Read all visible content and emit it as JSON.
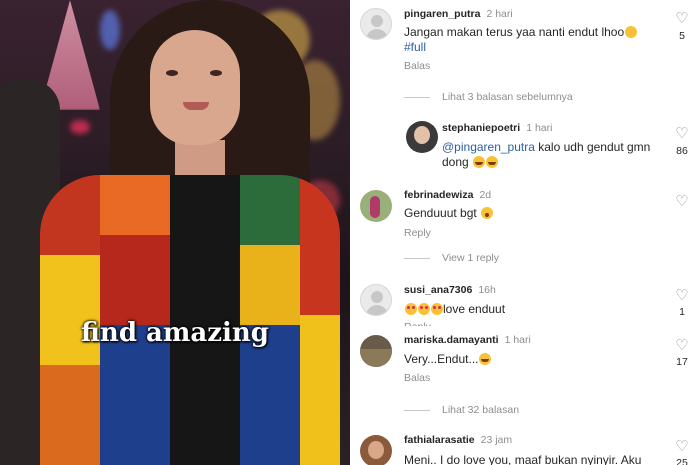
{
  "video": {
    "caption": "find amazing"
  },
  "comments": [
    {
      "username": "pingaren_putra",
      "time": "2 hari",
      "text": "Jangan makan terus yaa nanti endut lhoo",
      "hashtag": "#full",
      "reply_label": "Balas",
      "likes": "5",
      "avatar": "default-avatar"
    },
    {
      "more_replies": "Lihat 3 balasan sebelumnya"
    },
    {
      "username": "stephaniepoetri",
      "time": "1 hari",
      "mention": "@pingaren_putra",
      "text_line1": " kalo udh gendut gmn",
      "text_line2": "dong",
      "likes": "86",
      "avatar": "photo-avatar"
    },
    {
      "username": "febrinadewiza",
      "time": "2d",
      "text": "Genduuut bgt",
      "reply_label": "Reply",
      "avatar": "photo-avatar"
    },
    {
      "more_replies": "View 1 reply"
    },
    {
      "username": "susi_ana7306",
      "time": "16h",
      "text": "love enduut",
      "reply_label": "Reply",
      "likes": "1",
      "avatar": "default-avatar"
    },
    {
      "username": "mariska.damayanti",
      "time": "1 hari",
      "text": "Very...Endut...",
      "reply_label": "Balas",
      "likes": "17",
      "avatar": "photo-avatar"
    },
    {
      "more_replies": "Lihat 32 balasan"
    },
    {
      "username": "fathialarasatie",
      "time": "23 jam",
      "text": "Meni.. I do love you, maaf bukan nyinyir. Aku",
      "likes": "25",
      "avatar": "photo-avatar"
    }
  ],
  "icons": {
    "heart": "heart-outline-icon"
  },
  "colors": {
    "link": "#2f5fa3",
    "muted": "#8e8e8e",
    "text": "#262626"
  }
}
